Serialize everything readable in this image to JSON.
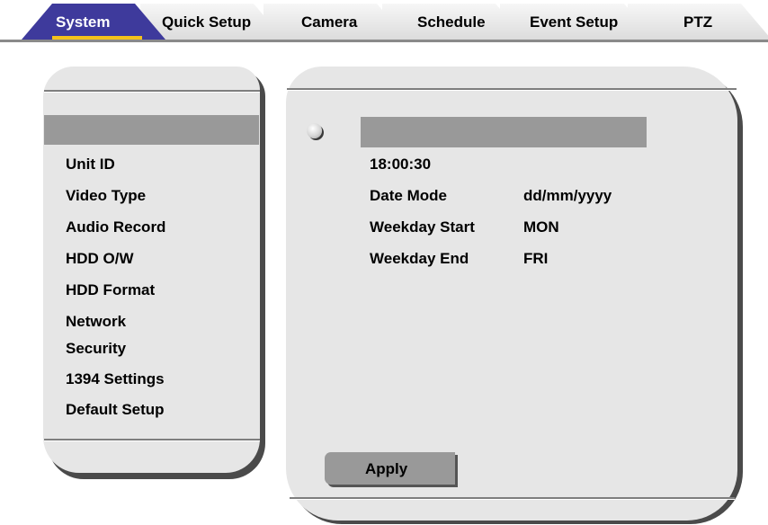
{
  "tabs": [
    {
      "label": "System",
      "active": true
    },
    {
      "label": "Quick Setup",
      "active": false
    },
    {
      "label": "Camera",
      "active": false
    },
    {
      "label": "Schedule",
      "active": false
    },
    {
      "label": "Event Setup",
      "active": false
    },
    {
      "label": "PTZ",
      "active": false
    }
  ],
  "sidebar": {
    "selected_item": "",
    "items": [
      {
        "label": "Unit ID"
      },
      {
        "label": "Video Type"
      },
      {
        "label": "Audio Record"
      },
      {
        "label": "HDD O/W"
      },
      {
        "label": "HDD Format"
      },
      {
        "label": "Network"
      },
      {
        "label": "Security"
      },
      {
        "label": "1394 Settings"
      },
      {
        "label": "Default Setup"
      }
    ]
  },
  "main": {
    "selected_field_value": "",
    "time": "18:00:30",
    "rows": [
      {
        "label": "Date Mode",
        "value": "dd/mm/yyyy"
      },
      {
        "label": "Weekday Start",
        "value": "MON"
      },
      {
        "label": "Weekday End",
        "value": "FRI"
      }
    ],
    "apply_label": "Apply"
  },
  "colors": {
    "active_tab": "#3e3a9c",
    "active_tab_underline": "#f4c21a",
    "panel_bg": "#e6e6e6",
    "highlight": "#999999"
  }
}
